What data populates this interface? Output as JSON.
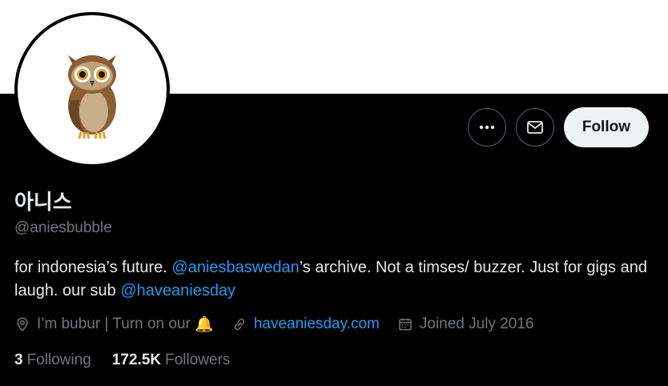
{
  "profile": {
    "display_name": "아니스",
    "handle": "@aniesbubble",
    "bio": {
      "part1": "for indonesia’s future. ",
      "mention1": "@aniesbaswedan",
      "part2": "’s archive. Not a timses/ buzzer. Just for gigs and laugh. our sub ",
      "mention2": "@haveaniesday"
    },
    "location": "I’m bubur | Turn on our",
    "location_emoji": "🔔",
    "website": "haveaniesday.com",
    "joined": "Joined July 2016",
    "following_count": "3",
    "following_label": "Following",
    "followers_count": "172.5K",
    "followers_label": "Followers"
  },
  "actions": {
    "follow_label": "Follow",
    "more_icon": "more-icon",
    "message_icon": "envelope-icon"
  },
  "colors": {
    "background": "#000000",
    "banner": "#ffffff",
    "link": "#1d9bf0",
    "secondary_text": "#71767b"
  }
}
